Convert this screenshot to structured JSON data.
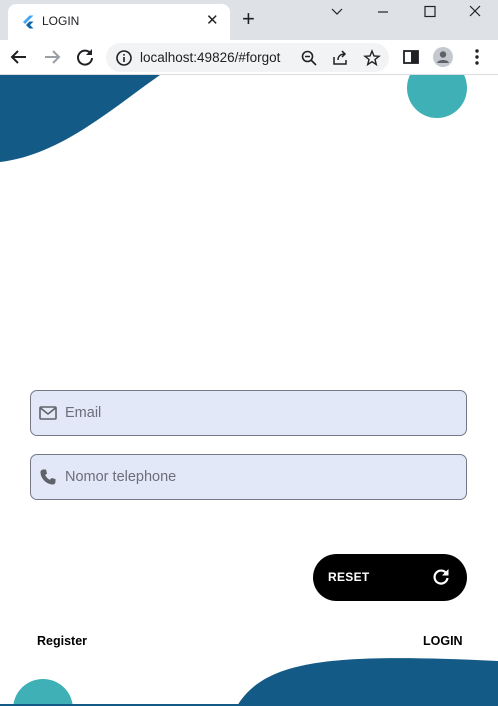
{
  "browser": {
    "tab": {
      "title": "LOGIN",
      "close_glyph": "✕"
    },
    "new_tab_glyph": "+",
    "omnibox": {
      "url_host": "localhost",
      "url_rest": ":49826/#forgot"
    }
  },
  "form": {
    "email": {
      "placeholder": "Email",
      "value": "",
      "icon": "mail-icon"
    },
    "phone": {
      "placeholder": "Nomor telephone",
      "value": "",
      "icon": "phone-icon"
    },
    "reset_button": {
      "label": "RESET",
      "icon": "refresh-icon"
    }
  },
  "links": {
    "register": "Register",
    "login": "LOGIN"
  },
  "colors": {
    "primary_blue": "#145a86",
    "teal": "#3fb0b5",
    "field_bg": "#e3e8f8"
  }
}
